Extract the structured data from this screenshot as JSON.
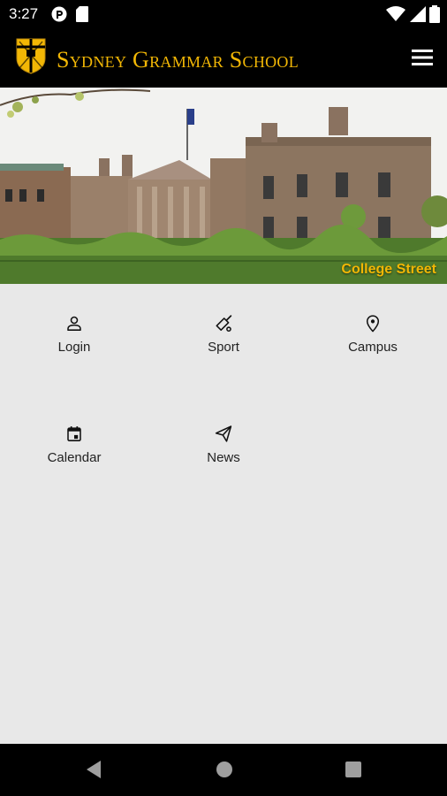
{
  "status_bar": {
    "time": "3:27",
    "left_icons": [
      "pocket-casts-icon",
      "sd-card-icon"
    ],
    "right_icons": [
      "wifi-icon",
      "cell-signal-icon",
      "battery-icon"
    ]
  },
  "app_bar": {
    "title": "Sydney Grammar School",
    "brand_color": "#f2b705",
    "menu_icon": "hamburger-menu-icon"
  },
  "hero": {
    "caption": "College Street"
  },
  "tiles": [
    {
      "label": "Login",
      "icon": "person-icon"
    },
    {
      "label": "Sport",
      "icon": "cricket-bat-icon"
    },
    {
      "label": "Campus",
      "icon": "map-pin-icon"
    },
    {
      "label": "Calendar",
      "icon": "calendar-icon"
    },
    {
      "label": "News",
      "icon": "paper-plane-icon"
    }
  ],
  "nav_bar": {
    "buttons": [
      "back-icon",
      "home-icon",
      "recents-icon"
    ]
  }
}
